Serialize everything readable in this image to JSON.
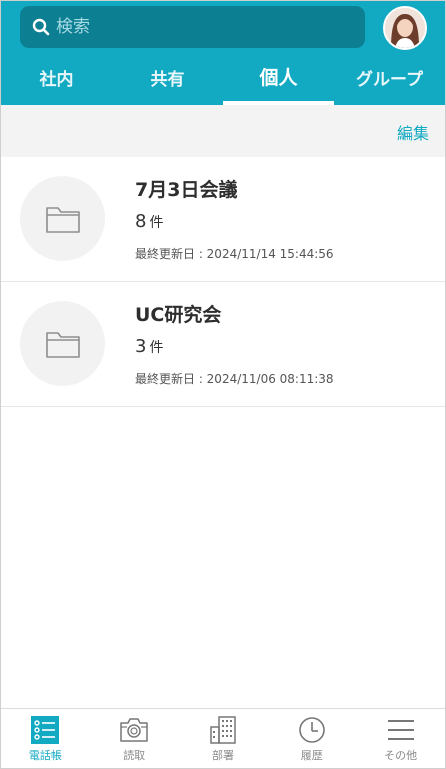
{
  "search": {
    "placeholder": "検索"
  },
  "tabs": [
    {
      "label": "社内"
    },
    {
      "label": "共有"
    },
    {
      "label": "個人",
      "active": true
    },
    {
      "label": "グループ"
    }
  ],
  "toolbar": {
    "edit_label": "編集"
  },
  "folders": [
    {
      "title": "7月3日会議",
      "count": "8",
      "count_unit": "件",
      "updated": "最終更新日 : 2024/11/14 15:44:56"
    },
    {
      "title": "UC研究会",
      "count": "3",
      "count_unit": "件",
      "updated": "最終更新日 : 2024/11/06 08:11:38"
    }
  ],
  "bottom_nav": [
    {
      "label": "電話帳",
      "icon": "phonebook-list-icon",
      "active": true
    },
    {
      "label": "読取",
      "icon": "camera-icon"
    },
    {
      "label": "部署",
      "icon": "building-icon"
    },
    {
      "label": "履歴",
      "icon": "clock-icon"
    },
    {
      "label": "その他",
      "icon": "menu-lines-icon"
    }
  ],
  "colors": {
    "accent": "#12a9c3",
    "accent_dark": "#0d7f93",
    "toolbar_bg": "#f3f3f3"
  }
}
